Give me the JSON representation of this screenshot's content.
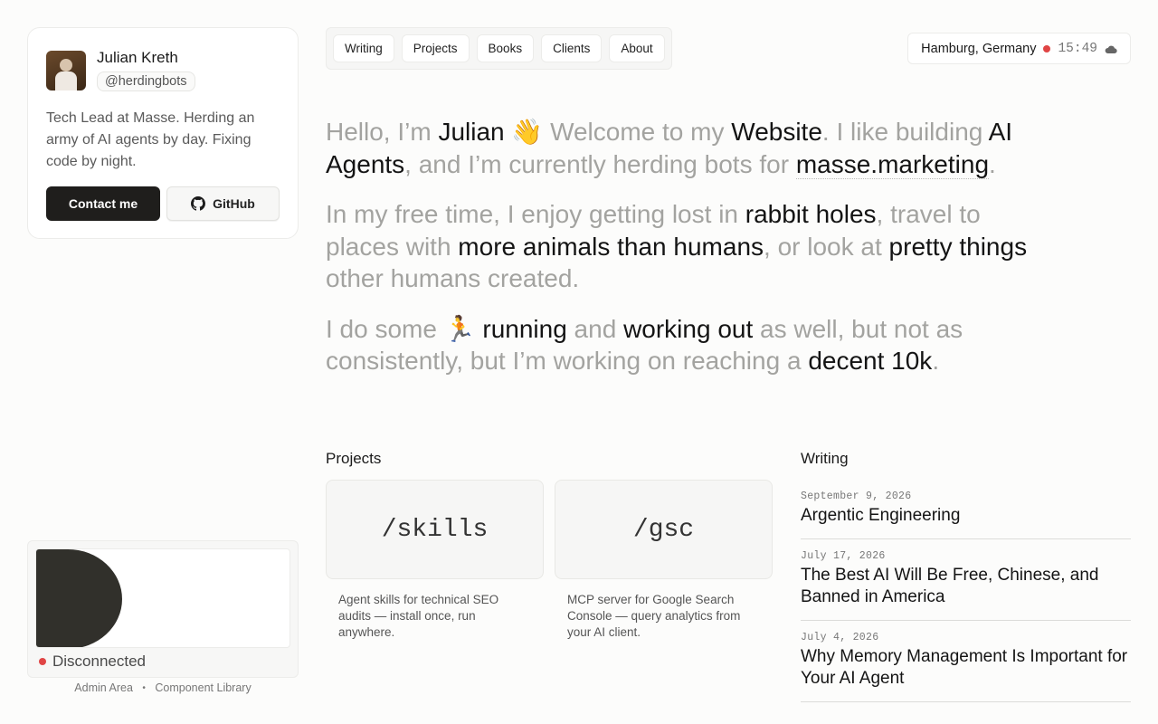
{
  "profile": {
    "name": "Julian Kreth",
    "handle": "@herdingbots",
    "bio": "Tech Lead at Masse. Herding an army of AI agents by day. Fixing code by night.",
    "contact_label": "Contact me",
    "github_label": "GitHub"
  },
  "status": {
    "text": "Disconnected"
  },
  "footer": {
    "admin": "Admin Area",
    "separator": "•",
    "library": "Component Library"
  },
  "nav": {
    "items": [
      "Writing",
      "Projects",
      "Books",
      "Clients",
      "About"
    ]
  },
  "location": {
    "city": "Hamburg, Germany",
    "time": "15:49"
  },
  "intro": {
    "p1": [
      "Hello, I’m ",
      "Julian",
      " 👋 Welcome to my ",
      "Website",
      ". I like building ",
      "AI Agents",
      ", and I’m currently herding bots for ",
      "masse.marketing",
      "."
    ],
    "p2": [
      "In my free time, I enjoy getting lost in ",
      "rabbit holes",
      ", travel to places with ",
      "more animals than humans",
      ", or look at ",
      "pretty things",
      " other humans created."
    ],
    "p3": [
      "I do some 🏃 ",
      "running",
      " and ",
      "working out",
      " as well, but not as consistently, but I’m working on reaching a ",
      "decent 10k",
      "."
    ]
  },
  "projects": {
    "title": "Projects",
    "items": [
      {
        "name": "/skills",
        "desc": "Agent skills for technical SEO audits — install once, run anywhere."
      },
      {
        "name": "/gsc",
        "desc": "MCP server for Google Search Console — query analytics from your AI client."
      }
    ]
  },
  "writing": {
    "title": "Writing",
    "posts": [
      {
        "date": "September 9, 2026",
        "title": "Argentic Engineering"
      },
      {
        "date": "July 17, 2026",
        "title": "The Best AI Will Be Free, Chinese, and Banned in America"
      },
      {
        "date": "July 4, 2026",
        "title": "Why Memory Management Is Important for Your AI Agent"
      }
    ]
  },
  "colors": {
    "accent_dark": "#1f1e1c",
    "status_red": "#e04545",
    "muted_text": "#a3a3a0"
  },
  "icons": {
    "github": "github-icon",
    "cloud": "cloud-icon",
    "status": "red-dot-icon"
  }
}
